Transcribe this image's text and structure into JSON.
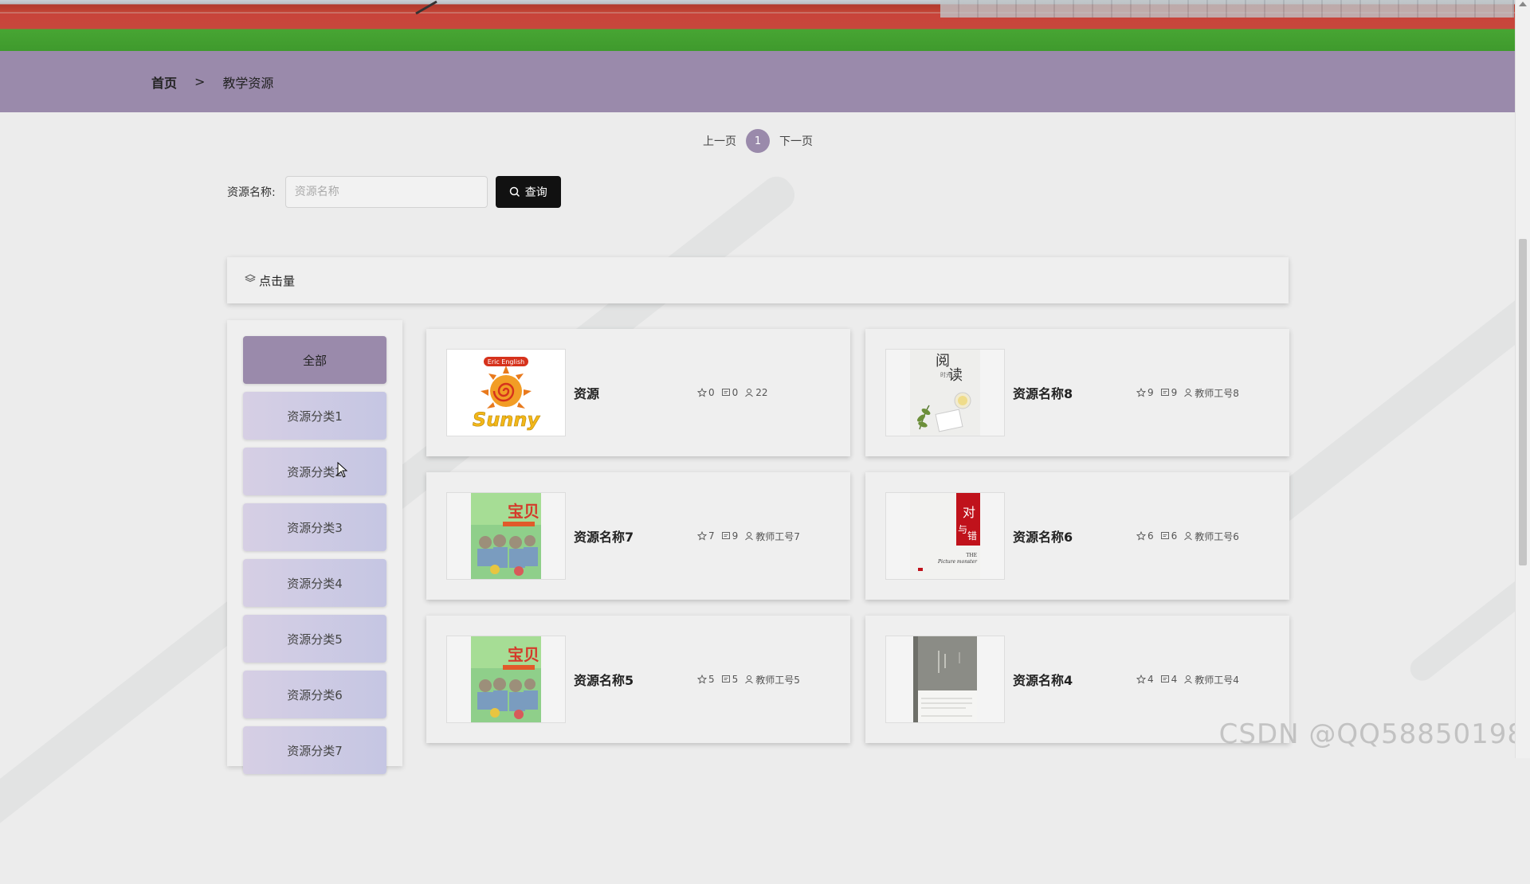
{
  "breadcrumb": {
    "home": "首页",
    "separator": ">",
    "current": "教学资源"
  },
  "pager": {
    "prev": "上一页",
    "current": "1",
    "next": "下一页"
  },
  "search": {
    "label": "资源名称:",
    "placeholder": "资源名称",
    "button": "查询"
  },
  "sort": {
    "label": "点击量"
  },
  "categories": [
    {
      "label": "全部",
      "active": true
    },
    {
      "label": "资源分类1"
    },
    {
      "label": "资源分类2"
    },
    {
      "label": "资源分类3"
    },
    {
      "label": "资源分类4"
    },
    {
      "label": "资源分类5"
    },
    {
      "label": "资源分类6"
    },
    {
      "label": "资源分类7"
    }
  ],
  "cover_texts": {
    "sunny": "Sunny",
    "sunny_badge": "Eric English",
    "read_a": "阅",
    "read_b": "读",
    "read_small": "时光",
    "baby": "宝贝",
    "duicuo_a": "对",
    "duicuo_b": "与",
    "duicuo_c": "错",
    "duicuo_en_a": "THE",
    "duicuo_en_b": "Picture monster"
  },
  "cards": [
    {
      "title": "资源",
      "likes": "0",
      "comments": "0",
      "author": "22",
      "cover": "sunny"
    },
    {
      "title": "资源名称8",
      "likes": "9",
      "comments": "9",
      "author": "教师工号8",
      "cover": "read"
    },
    {
      "title": "资源名称7",
      "likes": "7",
      "comments": "9",
      "author": "教师工号7",
      "cover": "baby"
    },
    {
      "title": "资源名称6",
      "likes": "6",
      "comments": "6",
      "author": "教师工号6",
      "cover": "duicuo"
    },
    {
      "title": "资源名称5",
      "likes": "5",
      "comments": "5",
      "author": "教师工号5",
      "cover": "baby"
    },
    {
      "title": "资源名称4",
      "likes": "4",
      "comments": "4",
      "author": "教师工号4",
      "cover": "grey"
    }
  ],
  "watermark": "CSDN @QQ58850198",
  "colors": {
    "accent": "#9a8aab",
    "button": "#111111",
    "category_bg": "#c5c6e3"
  }
}
